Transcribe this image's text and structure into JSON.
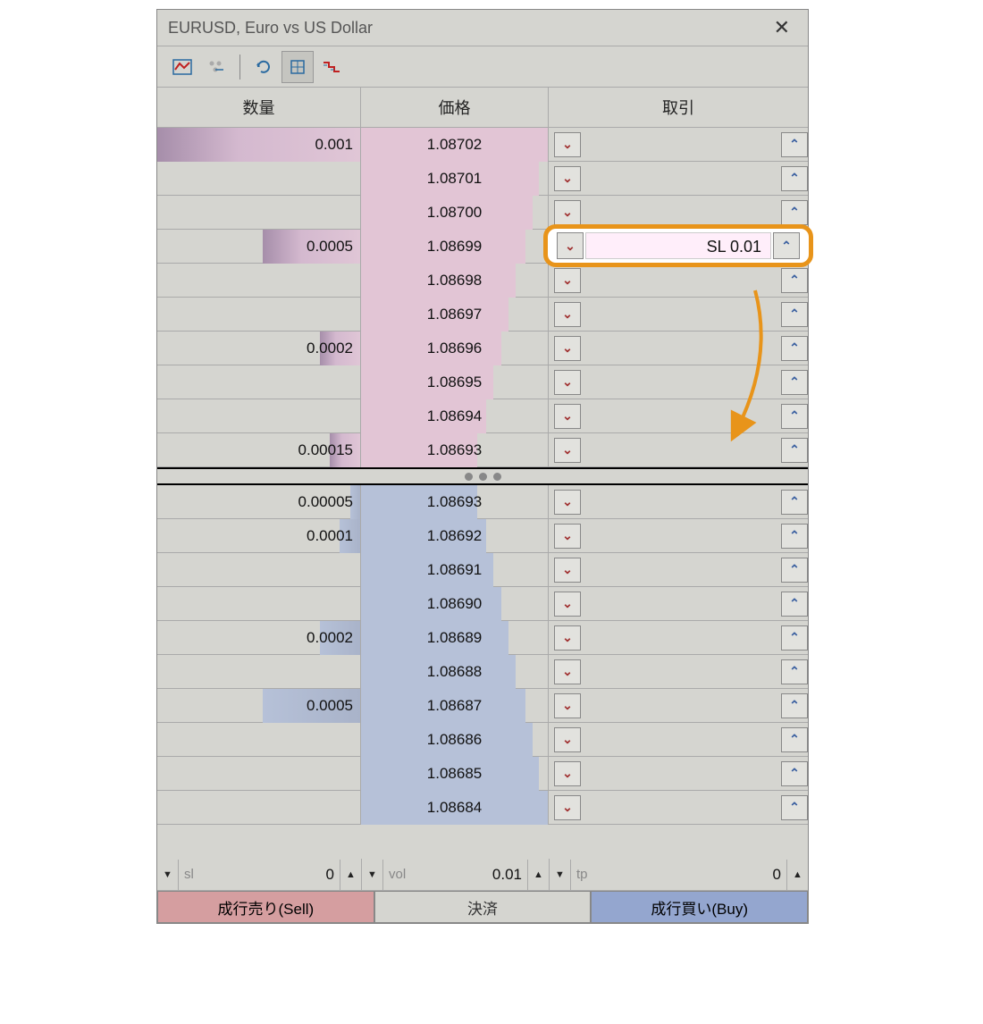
{
  "title": "EURUSD, Euro vs US Dollar",
  "headers": {
    "qty": "数量",
    "price": "価格",
    "trade": "取引"
  },
  "sell_rows": [
    {
      "qty": "0.001",
      "price": "1.08702",
      "qbar": 100,
      "pbar": 100
    },
    {
      "qty": "",
      "price": "1.08701",
      "qbar": 0,
      "pbar": 95
    },
    {
      "qty": "",
      "price": "1.08700",
      "qbar": 0,
      "pbar": 92
    },
    {
      "qty": "0.0005",
      "price": "1.08699",
      "qbar": 48,
      "pbar": 88,
      "highlight": "SL 0.01"
    },
    {
      "qty": "",
      "price": "1.08698",
      "qbar": 0,
      "pbar": 83
    },
    {
      "qty": "",
      "price": "1.08697",
      "qbar": 0,
      "pbar": 79
    },
    {
      "qty": "0.0002",
      "price": "1.08696",
      "qbar": 20,
      "pbar": 75
    },
    {
      "qty": "",
      "price": "1.08695",
      "qbar": 0,
      "pbar": 71
    },
    {
      "qty": "",
      "price": "1.08694",
      "qbar": 0,
      "pbar": 67
    },
    {
      "qty": "0.00015",
      "price": "1.08693",
      "qbar": 15,
      "pbar": 62
    }
  ],
  "buy_rows": [
    {
      "qty": "0.00005",
      "price": "1.08693",
      "qbar": 5,
      "pbar": 62
    },
    {
      "qty": "0.0001",
      "price": "1.08692",
      "qbar": 10,
      "pbar": 67
    },
    {
      "qty": "",
      "price": "1.08691",
      "qbar": 0,
      "pbar": 71
    },
    {
      "qty": "",
      "price": "1.08690",
      "qbar": 0,
      "pbar": 75
    },
    {
      "qty": "0.0002",
      "price": "1.08689",
      "qbar": 20,
      "pbar": 79
    },
    {
      "qty": "",
      "price": "1.08688",
      "qbar": 0,
      "pbar": 83
    },
    {
      "qty": "0.0005",
      "price": "1.08687",
      "qbar": 48,
      "pbar": 88
    },
    {
      "qty": "",
      "price": "1.08686",
      "qbar": 0,
      "pbar": 92
    },
    {
      "qty": "",
      "price": "1.08685",
      "qbar": 0,
      "pbar": 95
    },
    {
      "qty": "",
      "price": "1.08684",
      "qbar": 0,
      "pbar": 100
    }
  ],
  "footer": {
    "sl": {
      "label": "sl",
      "value": "0"
    },
    "vol": {
      "label": "vol",
      "value": "0.01"
    },
    "tp": {
      "label": "tp",
      "value": "0"
    }
  },
  "actions": {
    "sell": "成行売り(Sell)",
    "close": "決済",
    "buy": "成行買い(Buy)"
  }
}
